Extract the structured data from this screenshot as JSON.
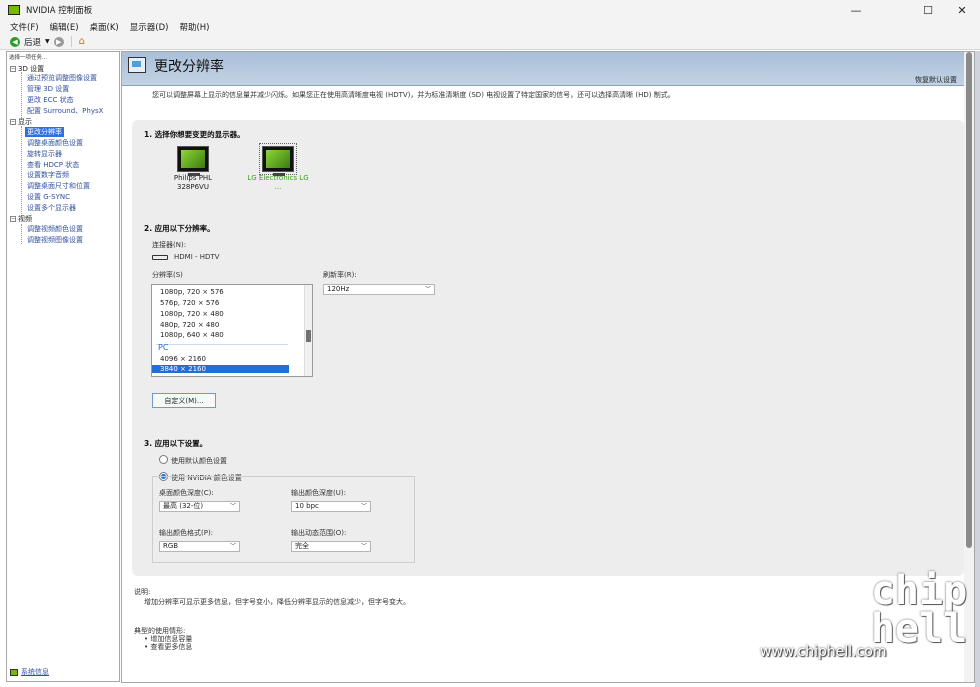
{
  "window": {
    "title": "NVIDIA 控制面板"
  },
  "menu": [
    "文件(F)",
    "编辑(E)",
    "桌面(K)",
    "显示器(D)",
    "帮助(H)"
  ],
  "toolbar": {
    "back_label": "后退"
  },
  "tree": {
    "task_label": "选择一项任务...",
    "categories": [
      {
        "label": "3D 设置",
        "items": [
          "通过预览调整图像设置",
          "管理 3D 设置",
          "更改 ECC 状态",
          "配置 Surround、PhysX"
        ]
      },
      {
        "label": "显示",
        "items": [
          "更改分辨率",
          "调整桌面颜色设置",
          "旋转显示器",
          "查看 HDCP 状态",
          "设置数字音频",
          "调整桌面尺寸和位置",
          "设置 G-SYNC",
          "设置多个显示器"
        ]
      },
      {
        "label": "视频",
        "items": [
          "调整视频颜色设置",
          "调整视频图像设置"
        ]
      }
    ],
    "selected": "更改分辨率",
    "system_info": "系统信息"
  },
  "page": {
    "title": "更改分辨率",
    "restore": "恢复默认设置",
    "description": "您可以调整屏幕上显示的信息量并减少闪烁。如果您正在使用高清晰度电视 (HDTV)，并为标准清晰度 (SD) 电视设置了特定国家的信号，还可以选择高清晰 (HD) 制式。"
  },
  "step1": {
    "heading": "1. 选择你想要变更的显示器。",
    "displays": [
      {
        "name": "Philips PHL 328P6VU",
        "line1": "Philips PHL",
        "line2": "328P6VU",
        "color": "#222222"
      },
      {
        "name": "LG Electronics LG ...",
        "line1": "LG Electronics LG",
        "line2": "...",
        "color": "#3aa020"
      }
    ]
  },
  "step2": {
    "heading": "2. 应用以下分辨率。",
    "connector_label": "连接器(N):",
    "connector_value": "HDMI - HDTV",
    "resolution_label": "分辨率(S)",
    "refresh_label": "刷新率(R):",
    "refresh_value": "120Hz",
    "resolutions": [
      "1080p, 720 × 576",
      "576p, 720 × 576",
      "1080p, 720 × 480",
      "480p, 720 × 480",
      "1080p, 640 × 480"
    ],
    "pc_group": "PC",
    "pc_resolutions": [
      "4096 × 2160",
      "3840 × 2160"
    ],
    "selected_resolution": "3840 × 2160",
    "custom_button": "自定义(M)..."
  },
  "step3": {
    "heading": "3. 应用以下设置。",
    "radio_default": "使用默认颜色设置",
    "radio_nvidia": "使用 NVIDIA 颜色设置",
    "selected_radio": "使用 NVIDIA 颜色设置",
    "desktop_depth_label": "桌面颜色深度(C):",
    "desktop_depth_value": "最高 (32-位)",
    "output_depth_label": "输出颜色深度(U):",
    "output_depth_value": "10 bpc",
    "output_format_label": "输出颜色格式(P):",
    "output_format_value": "RGB",
    "dynamic_range_label": "输出动态范围(O):",
    "dynamic_range_value": "完全"
  },
  "notes": {
    "heading": "说明:",
    "text": "增加分辨率可显示更多信息，但字号变小，降低分辨率显示的信息减少，但字号变大。"
  },
  "usage": {
    "heading": "典型的使用情形:",
    "items": [
      "增加信息容量",
      "查看更多信息"
    ]
  },
  "watermark": {
    "logo": "chip hell",
    "url": "www.chiphell.com"
  },
  "colors": {
    "nvidia_green": "#76b900",
    "selection_blue": "#1f6fd8",
    "header_bg": "#b4c6dc"
  }
}
